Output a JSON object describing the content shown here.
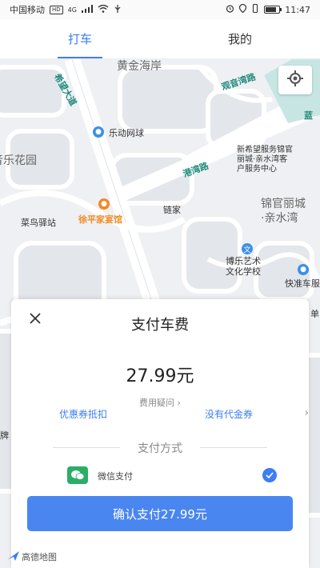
{
  "status_bar": {
    "carrier": "中国移动",
    "network": "4G",
    "hd": "HD",
    "battery_level": 0.8,
    "time": "11:47"
  },
  "tabs": [
    {
      "label": "打车",
      "active": true
    },
    {
      "label": "我的",
      "active": false
    }
  ],
  "map": {
    "labels": {
      "huangjin": "黄金海岸",
      "xiwang": "希望大道",
      "guanwan": "观音湾路",
      "lan": "蓝",
      "ledong": "乐动网球",
      "lehuayuan": "音乐花园",
      "xinxiwang": "新希望服务锦官\n丽城·亲水湾客\n户服务中心",
      "gangwan": "港湾路",
      "jinguan": "锦官丽城\n·亲水湾",
      "xupingjia": "徐平家宴馆",
      "lianjia": "链家",
      "cainiao": "菜鸟驿站",
      "bole": "博乐艺术\n文化学校",
      "kuaizhun": "快准车服",
      "dan": "单",
      "chuangpai": "牌"
    }
  },
  "payment": {
    "title": "支付车费",
    "price": "27.99元",
    "fee_question": "费用疑问",
    "coupon_label": "优惠券抵扣",
    "voucher_label": "没有代金券",
    "method_section": "支付方式",
    "method_name": "微信支付",
    "confirm_label": "确认支付27.99元"
  },
  "logo_text": "高德地图",
  "colors": {
    "accent": "#3d7ef0",
    "wechat": "#2aae67"
  }
}
